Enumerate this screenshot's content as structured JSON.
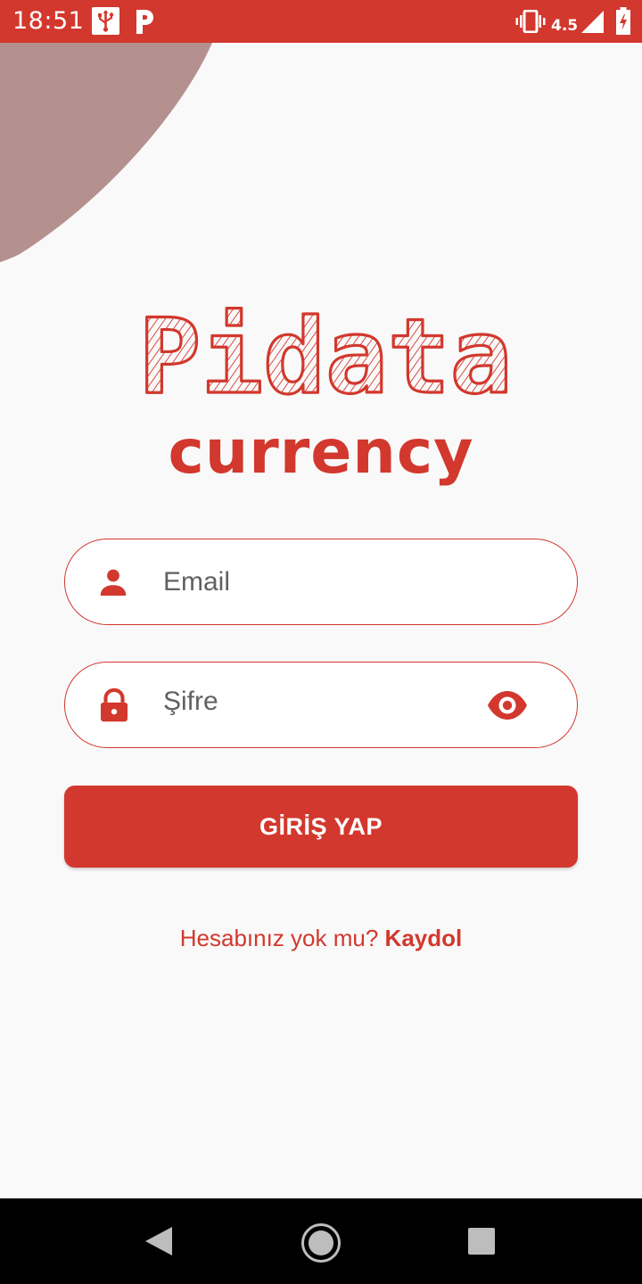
{
  "status_bar": {
    "time": "18:51",
    "icons": [
      "usb-icon",
      "parking-app-icon",
      "vibrate-icon",
      "network-4-5g-icon",
      "signal-icon",
      "battery-charging-icon"
    ],
    "network_label": "4.5G"
  },
  "colors": {
    "primary": "#d2382d",
    "blob": "#b4918f",
    "background": "#f9f9f9"
  },
  "logo": {
    "title": "Pidata",
    "subtitle": "currency"
  },
  "form": {
    "email_placeholder": "Email",
    "password_placeholder": "Şifre",
    "email_icon": "person-icon",
    "password_icon": "lock-icon",
    "visibility_icon": "eye-icon",
    "login_label": "GİRİŞ YAP"
  },
  "signup": {
    "prompt": "Hesabınız yok mu?",
    "link": "Kaydol"
  },
  "nav_bar": {
    "buttons": [
      "back-icon",
      "home-icon",
      "recents-icon"
    ]
  }
}
